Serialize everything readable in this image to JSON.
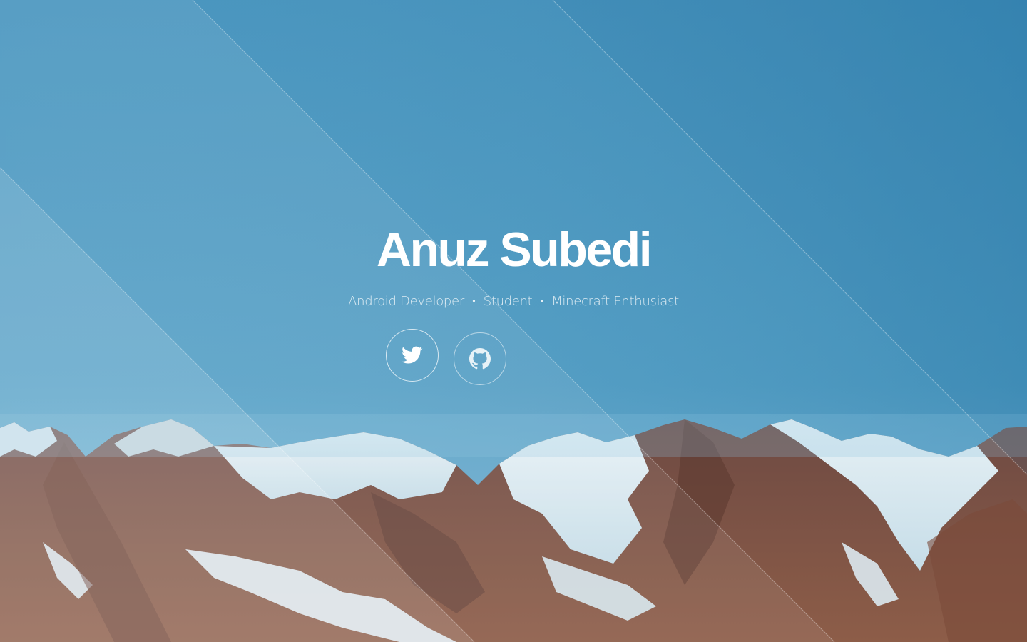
{
  "profile": {
    "name": "Anuz Subedi",
    "roles": [
      "Android Developer",
      "Student",
      "Minecraft Enthusiast"
    ],
    "separator": "•"
  },
  "social": [
    {
      "icon": "twitter-icon",
      "label": "Twitter"
    },
    {
      "icon": "github-icon",
      "label": "GitHub"
    }
  ],
  "colors": {
    "sky_top": "#4a97c1",
    "sky_bottom": "#6eb0d2",
    "accent": "#ffffff"
  }
}
